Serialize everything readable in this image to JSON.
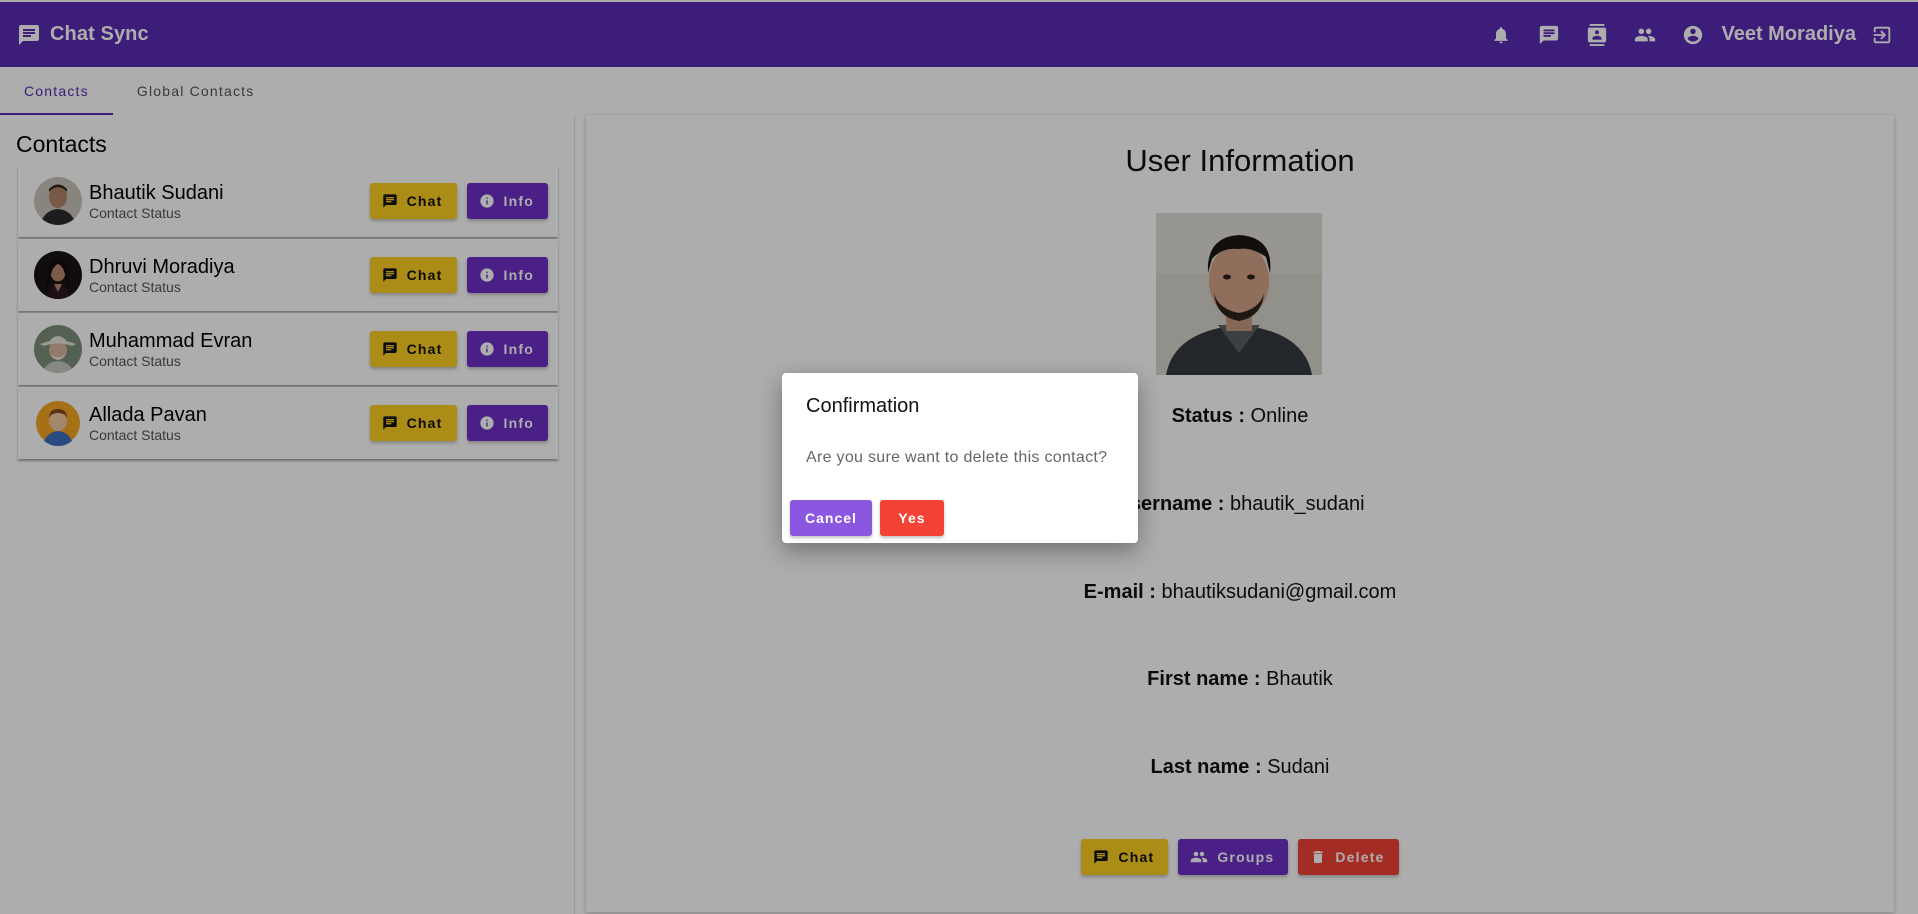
{
  "topbar": {
    "app_title": "Chat Sync",
    "user_name": "Veet Moradiya",
    "icons": [
      "chat-icon",
      "bell-icon",
      "message-icon",
      "contacts-icon",
      "group-icon",
      "account-circle-icon",
      "logout-icon"
    ]
  },
  "tabs": [
    {
      "label": "Contacts",
      "active": true
    },
    {
      "label": "Global Contacts",
      "active": false
    }
  ],
  "contacts": {
    "heading": "Contacts",
    "items": [
      {
        "name": "Bhautik Sudani",
        "status": "Contact Status",
        "chat_label": "Chat",
        "info_label": "Info"
      },
      {
        "name": "Dhruvi Moradiya",
        "status": "Contact Status",
        "chat_label": "Chat",
        "info_label": "Info"
      },
      {
        "name": "Muhammad Evran",
        "status": "Contact Status",
        "chat_label": "Chat",
        "info_label": "Info"
      },
      {
        "name": "Allada Pavan",
        "status": "Contact Status",
        "chat_label": "Chat",
        "info_label": "Info"
      }
    ]
  },
  "user_info": {
    "title": "User Information",
    "status_label": "Status :",
    "status_value": "Online",
    "username_label": "Username :",
    "username_value": "bhautik_sudani",
    "email_label": "E-mail :",
    "email_value": "bhautiksudani@gmail.com",
    "firstname_label": "First name :",
    "firstname_value": "Bhautik",
    "lastname_label": "Last name :",
    "lastname_value": "Sudani",
    "chat_label": "Chat",
    "groups_label": "Groups",
    "delete_label": "Delete"
  },
  "dialog": {
    "title": "Confirmation",
    "message": "Are you sure want to delete this contact?",
    "cancel_label": "Cancel",
    "yes_label": "Yes"
  },
  "colors": {
    "primary": "#5b2bb4",
    "chat_button": "#fdcf22",
    "info_button": "#6d30c6",
    "delete_button": "#f04337",
    "cancel_button": "#8b57e0"
  }
}
